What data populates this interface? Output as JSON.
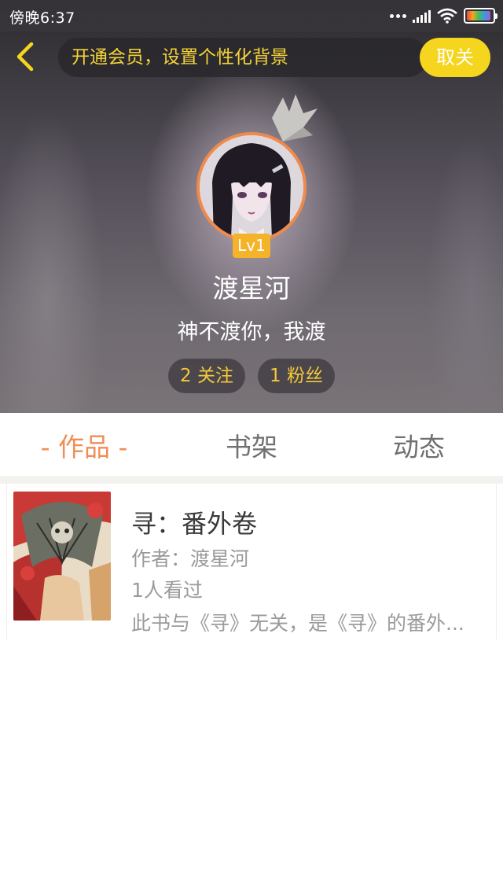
{
  "status_bar": {
    "time": "傍晚6:37",
    "icons": [
      "more-dots-icon",
      "signal-icon",
      "wifi-icon",
      "battery-icon"
    ]
  },
  "header": {
    "back_icon": "chevron-left-icon",
    "vip_banner_text": "开通会员，设置个性化背景",
    "unfollow_label": "取关",
    "accent_color": "#f5d51d"
  },
  "profile": {
    "level": "Lv1",
    "username": "渡星河",
    "signature": "神不渡你，我渡",
    "following": "2 关注",
    "fans": "1 粉丝",
    "avatar_border_color": "#f08a4b"
  },
  "tabs": [
    {
      "label": "- 作品 -",
      "active": true
    },
    {
      "label": "书架",
      "active": false
    },
    {
      "label": "动态",
      "active": false
    }
  ],
  "works": [
    {
      "title": "寻：番外卷",
      "author": "作者：渡星河",
      "views": "1人看过",
      "description": "此书与《寻》无关，是《寻》的番外..."
    }
  ],
  "colors": {
    "active_tab": "#f08e56",
    "inactive_tab": "#707070",
    "stat_text": "#f5c83a"
  }
}
